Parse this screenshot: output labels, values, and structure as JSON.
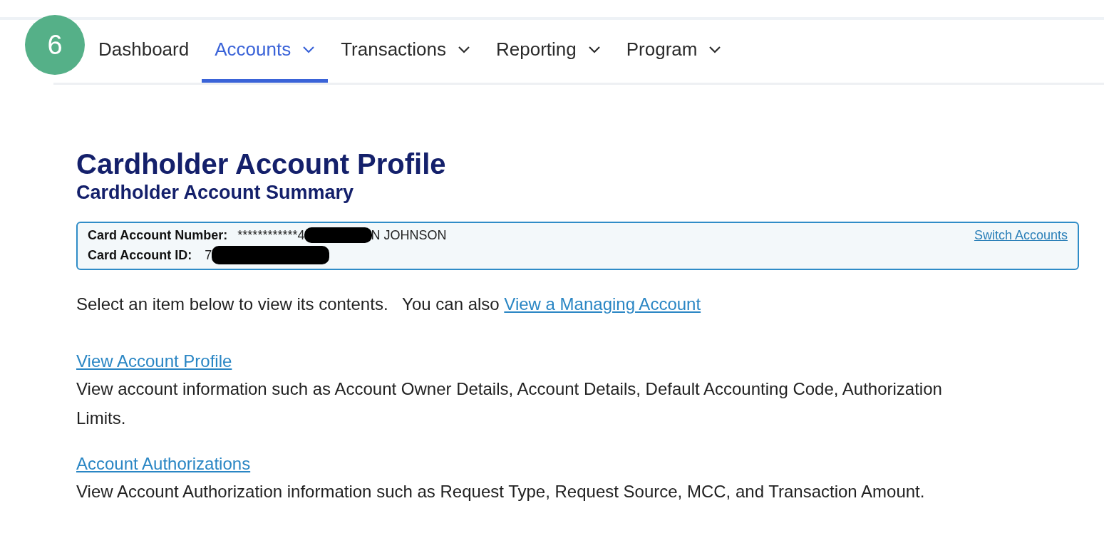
{
  "step_badge": "6",
  "nav": [
    {
      "label": "Dashboard",
      "dropdown": false,
      "selected": false
    },
    {
      "label": "Accounts",
      "dropdown": true,
      "selected": true
    },
    {
      "label": "Transactions",
      "dropdown": true,
      "selected": false
    },
    {
      "label": "Reporting",
      "dropdown": true,
      "selected": false
    },
    {
      "label": "Program",
      "dropdown": true,
      "selected": false
    }
  ],
  "page": {
    "title": "Cardholder Account Profile",
    "subtitle": "Cardholder Account Summary"
  },
  "account_box": {
    "rows": [
      {
        "label": "Card Account Number:",
        "value_start": "************4",
        "redacted": true,
        "value_end": "N JOHNSON"
      },
      {
        "label": "Card Account ID:",
        "value_start": "7",
        "redacted": true,
        "value_end": ""
      }
    ],
    "switch_link": "Switch Accounts"
  },
  "intro": {
    "text": "Select an item below to view its contents.   You can also ",
    "link": "View a Managing Account"
  },
  "items": [
    {
      "link": "View Account Profile",
      "description": "View account information such as Account Owner Details, Account Details, Default Accounting Code, Authorization Limits."
    },
    {
      "link": "Account Authorizations",
      "description": "View Account Authorization information such as Request Type, Request Source, MCC, and Transaction Amount."
    }
  ]
}
